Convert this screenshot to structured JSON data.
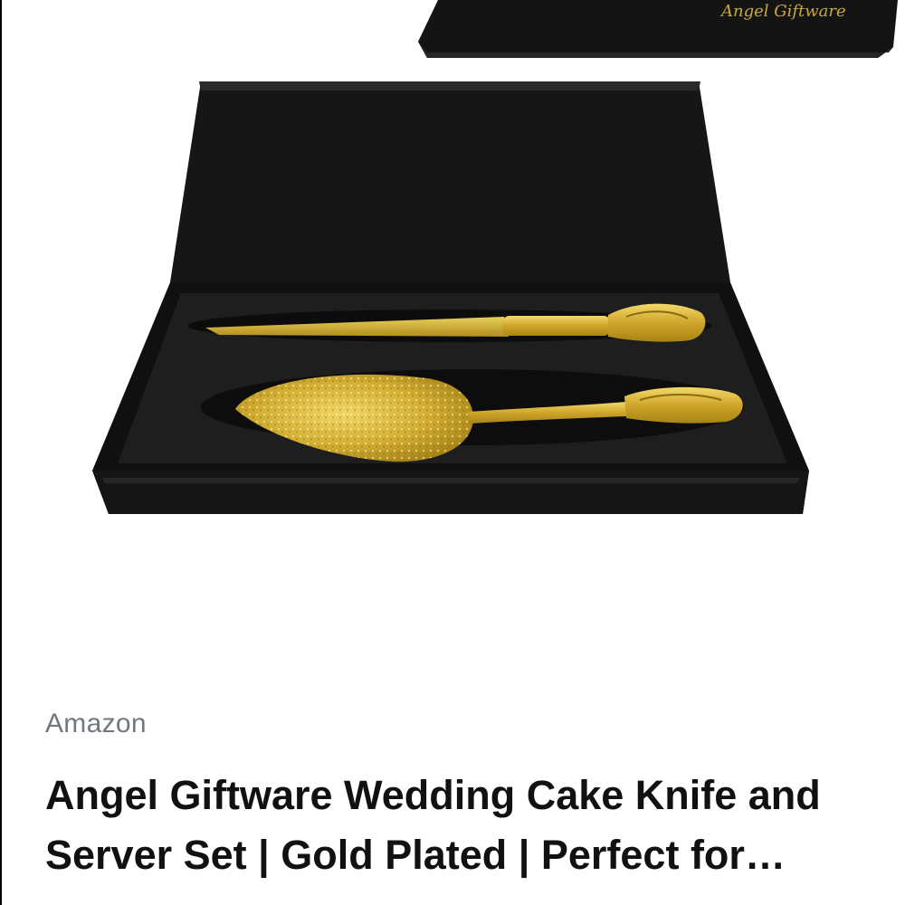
{
  "product": {
    "store": "Amazon",
    "title": "Angel Giftware Wedding Cake Knife and Server Set | Gold Plated | Perfect for Wedding",
    "box_brand_text": "Angel Giftware"
  },
  "colors": {
    "box_black": "#161616",
    "gold": "#d4b13a",
    "store_gray": "#707783",
    "title_black": "#111111"
  }
}
